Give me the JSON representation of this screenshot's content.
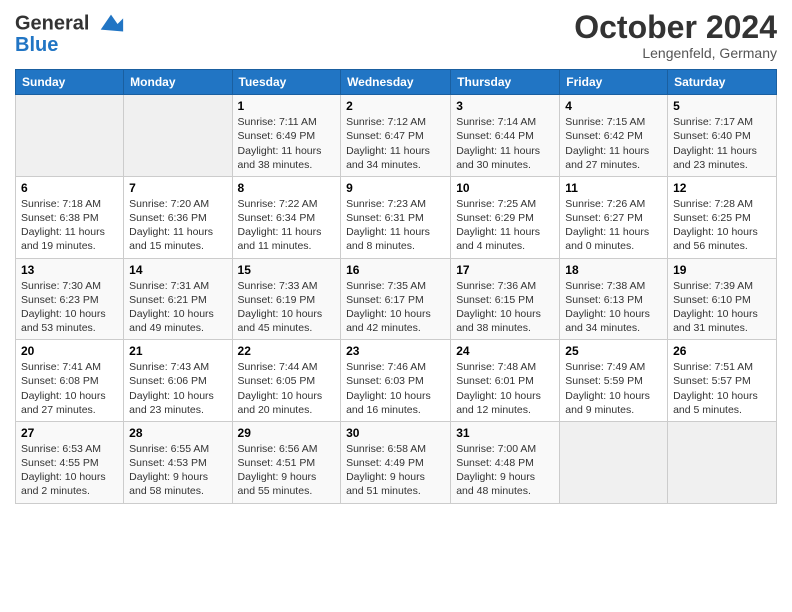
{
  "header": {
    "logo_line1": "General",
    "logo_line2": "Blue",
    "month": "October 2024",
    "location": "Lengenfeld, Germany"
  },
  "weekdays": [
    "Sunday",
    "Monday",
    "Tuesday",
    "Wednesday",
    "Thursday",
    "Friday",
    "Saturday"
  ],
  "weeks": [
    [
      {
        "day": "",
        "info": ""
      },
      {
        "day": "",
        "info": ""
      },
      {
        "day": "1",
        "info": "Sunrise: 7:11 AM\nSunset: 6:49 PM\nDaylight: 11 hours and 38 minutes."
      },
      {
        "day": "2",
        "info": "Sunrise: 7:12 AM\nSunset: 6:47 PM\nDaylight: 11 hours and 34 minutes."
      },
      {
        "day": "3",
        "info": "Sunrise: 7:14 AM\nSunset: 6:44 PM\nDaylight: 11 hours and 30 minutes."
      },
      {
        "day": "4",
        "info": "Sunrise: 7:15 AM\nSunset: 6:42 PM\nDaylight: 11 hours and 27 minutes."
      },
      {
        "day": "5",
        "info": "Sunrise: 7:17 AM\nSunset: 6:40 PM\nDaylight: 11 hours and 23 minutes."
      }
    ],
    [
      {
        "day": "6",
        "info": "Sunrise: 7:18 AM\nSunset: 6:38 PM\nDaylight: 11 hours and 19 minutes."
      },
      {
        "day": "7",
        "info": "Sunrise: 7:20 AM\nSunset: 6:36 PM\nDaylight: 11 hours and 15 minutes."
      },
      {
        "day": "8",
        "info": "Sunrise: 7:22 AM\nSunset: 6:34 PM\nDaylight: 11 hours and 11 minutes."
      },
      {
        "day": "9",
        "info": "Sunrise: 7:23 AM\nSunset: 6:31 PM\nDaylight: 11 hours and 8 minutes."
      },
      {
        "day": "10",
        "info": "Sunrise: 7:25 AM\nSunset: 6:29 PM\nDaylight: 11 hours and 4 minutes."
      },
      {
        "day": "11",
        "info": "Sunrise: 7:26 AM\nSunset: 6:27 PM\nDaylight: 11 hours and 0 minutes."
      },
      {
        "day": "12",
        "info": "Sunrise: 7:28 AM\nSunset: 6:25 PM\nDaylight: 10 hours and 56 minutes."
      }
    ],
    [
      {
        "day": "13",
        "info": "Sunrise: 7:30 AM\nSunset: 6:23 PM\nDaylight: 10 hours and 53 minutes."
      },
      {
        "day": "14",
        "info": "Sunrise: 7:31 AM\nSunset: 6:21 PM\nDaylight: 10 hours and 49 minutes."
      },
      {
        "day": "15",
        "info": "Sunrise: 7:33 AM\nSunset: 6:19 PM\nDaylight: 10 hours and 45 minutes."
      },
      {
        "day": "16",
        "info": "Sunrise: 7:35 AM\nSunset: 6:17 PM\nDaylight: 10 hours and 42 minutes."
      },
      {
        "day": "17",
        "info": "Sunrise: 7:36 AM\nSunset: 6:15 PM\nDaylight: 10 hours and 38 minutes."
      },
      {
        "day": "18",
        "info": "Sunrise: 7:38 AM\nSunset: 6:13 PM\nDaylight: 10 hours and 34 minutes."
      },
      {
        "day": "19",
        "info": "Sunrise: 7:39 AM\nSunset: 6:10 PM\nDaylight: 10 hours and 31 minutes."
      }
    ],
    [
      {
        "day": "20",
        "info": "Sunrise: 7:41 AM\nSunset: 6:08 PM\nDaylight: 10 hours and 27 minutes."
      },
      {
        "day": "21",
        "info": "Sunrise: 7:43 AM\nSunset: 6:06 PM\nDaylight: 10 hours and 23 minutes."
      },
      {
        "day": "22",
        "info": "Sunrise: 7:44 AM\nSunset: 6:05 PM\nDaylight: 10 hours and 20 minutes."
      },
      {
        "day": "23",
        "info": "Sunrise: 7:46 AM\nSunset: 6:03 PM\nDaylight: 10 hours and 16 minutes."
      },
      {
        "day": "24",
        "info": "Sunrise: 7:48 AM\nSunset: 6:01 PM\nDaylight: 10 hours and 12 minutes."
      },
      {
        "day": "25",
        "info": "Sunrise: 7:49 AM\nSunset: 5:59 PM\nDaylight: 10 hours and 9 minutes."
      },
      {
        "day": "26",
        "info": "Sunrise: 7:51 AM\nSunset: 5:57 PM\nDaylight: 10 hours and 5 minutes."
      }
    ],
    [
      {
        "day": "27",
        "info": "Sunrise: 6:53 AM\nSunset: 4:55 PM\nDaylight: 10 hours and 2 minutes."
      },
      {
        "day": "28",
        "info": "Sunrise: 6:55 AM\nSunset: 4:53 PM\nDaylight: 9 hours and 58 minutes."
      },
      {
        "day": "29",
        "info": "Sunrise: 6:56 AM\nSunset: 4:51 PM\nDaylight: 9 hours and 55 minutes."
      },
      {
        "day": "30",
        "info": "Sunrise: 6:58 AM\nSunset: 4:49 PM\nDaylight: 9 hours and 51 minutes."
      },
      {
        "day": "31",
        "info": "Sunrise: 7:00 AM\nSunset: 4:48 PM\nDaylight: 9 hours and 48 minutes."
      },
      {
        "day": "",
        "info": ""
      },
      {
        "day": "",
        "info": ""
      }
    ]
  ]
}
